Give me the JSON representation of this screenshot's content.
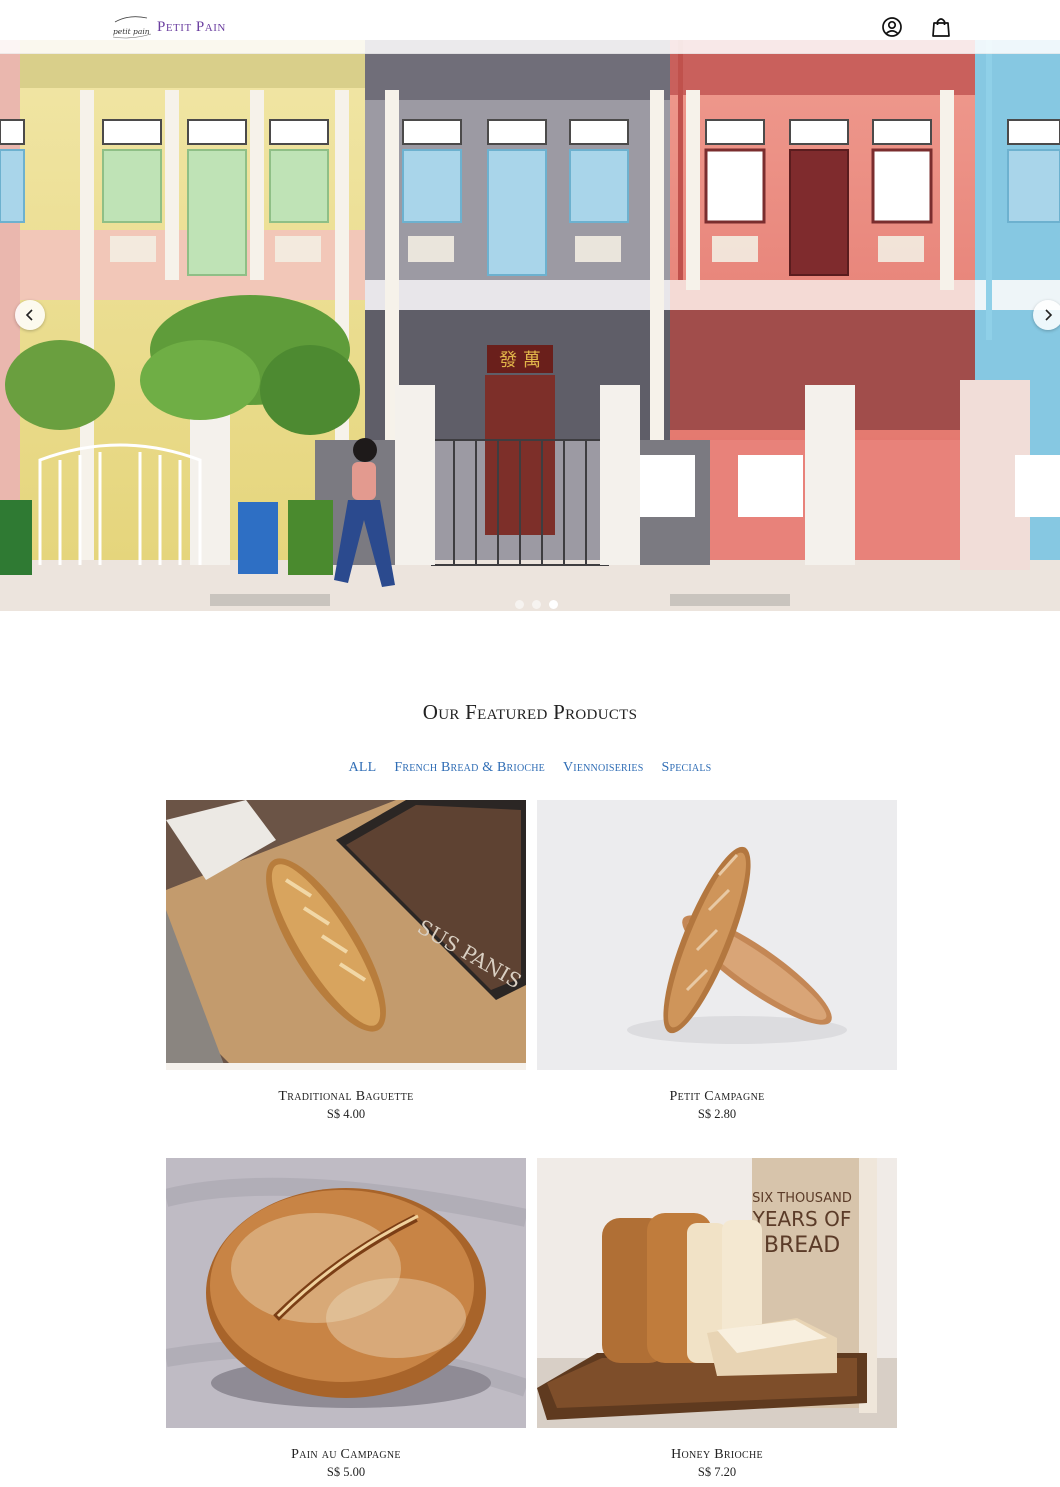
{
  "header": {
    "logo_script": "petit pain",
    "brand": "Petit Pain",
    "icons": [
      "account-icon",
      "cart-icon"
    ]
  },
  "hero": {
    "slides_total": 3,
    "active_slide": 3,
    "controls": [
      "chevron-left-icon",
      "chevron-right-icon"
    ],
    "signboard": "發 萬"
  },
  "featured": {
    "title": "Our Featured Products",
    "filters": [
      "ALL",
      "French Bread & Brioche",
      "Viennoiseries",
      "Specials"
    ],
    "products": [
      {
        "name": "Traditional Baguette",
        "price": "S$ 4.00"
      },
      {
        "name": "Petit Campagne",
        "price": "S$ 2.80"
      },
      {
        "name": "Pain au Campagne",
        "price": "S$ 5.00"
      },
      {
        "name": "Honey Brioche",
        "price": "S$ 7.20"
      }
    ],
    "photo_text": {
      "baguette_book": "SUS PANIS",
      "brioche_book": [
        "SIX THOUSAND",
        "YEARS OF",
        "BREAD"
      ]
    }
  },
  "colors": {
    "brand": "#6b3fa0",
    "filter_link": "#2f6db5",
    "house_yellow": "#e9df8f",
    "house_grey": "#8d8c94",
    "house_coral": "#e7837a",
    "house_blue": "#7cc2dd"
  }
}
